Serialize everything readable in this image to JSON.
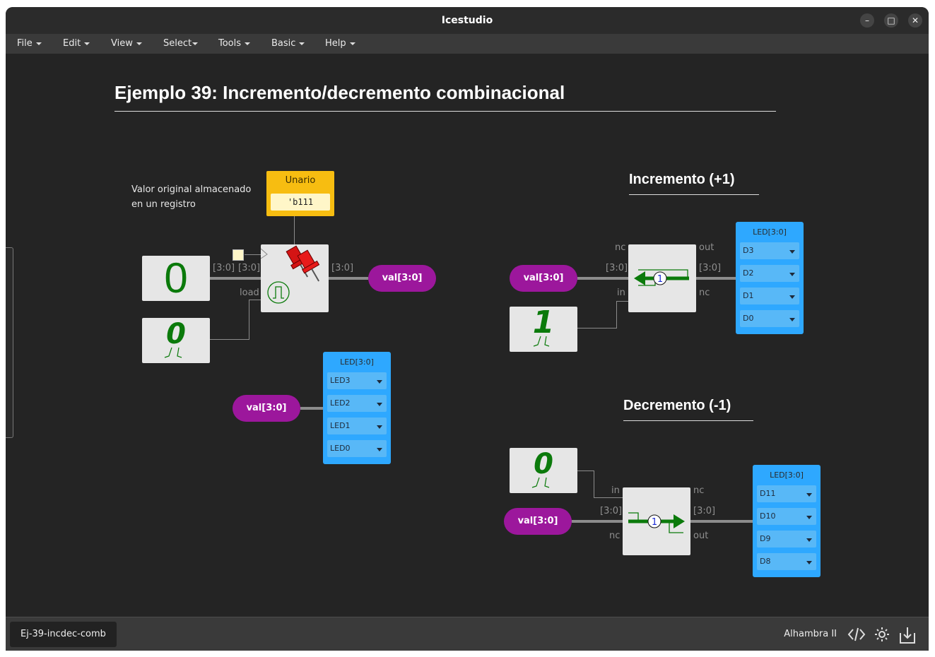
{
  "window": {
    "title": "Icestudio",
    "minimize": "–",
    "maximize": "□",
    "close": "✕"
  },
  "menu": [
    {
      "label": "File",
      "id": "file"
    },
    {
      "label": "Edit",
      "id": "edit"
    },
    {
      "label": "View",
      "id": "view"
    },
    {
      "label": "Select",
      "id": "select"
    },
    {
      "label": "Tools",
      "id": "tools"
    },
    {
      "label": "Basic",
      "id": "basic"
    },
    {
      "label": "Help",
      "id": "help"
    }
  ],
  "canvas": {
    "title": "Ejemplo 39: Incremento/decremento combinacional",
    "note_line1": "Valor original almacenado",
    "note_line2": "en un registro",
    "section_inc": "Incremento (+1)",
    "section_dec": "Decremento (-1)",
    "constant": {
      "name": "Unario",
      "value": "'b111"
    },
    "register": {
      "pin_in": "[3:0]",
      "pin_data": "[3:0]",
      "pin_load": "load",
      "pin_out": "[3:0]"
    },
    "const_zero_big": "0",
    "const_zero_small": "0",
    "const_one": "1",
    "const_zero_dec": "0",
    "val_label": "val[3:0]",
    "inc": {
      "nc_top": "nc",
      "out": "out",
      "in_bus": "[3:0]",
      "out_bus": "[3:0]",
      "in": "in",
      "nc_bottom": "nc",
      "symbol": "1"
    },
    "dec": {
      "in": "in",
      "nc_top": "nc",
      "in_bus": "[3:0]",
      "out_bus": "[3:0]",
      "nc_bottom": "nc",
      "out": "out",
      "symbol": "1"
    },
    "led_left": {
      "header": "LED[3:0]",
      "pins": [
        "LED3",
        "LED2",
        "LED1",
        "LED0"
      ]
    },
    "led_inc": {
      "header": "LED[3:0]",
      "pins": [
        "D3",
        "D2",
        "D1",
        "D0"
      ]
    },
    "led_dec": {
      "header": "LED[3:0]",
      "pins": [
        "D11",
        "D10",
        "D9",
        "D8"
      ]
    }
  },
  "status": {
    "file": "Ej-39-incdec-comb",
    "board": "Alhambra II"
  },
  "colors": {
    "label": "#9c179c",
    "led": "#2ea8ff",
    "constant": "#f7bd11",
    "wire": "#8c8c8c",
    "green": "#0b7a0b"
  }
}
